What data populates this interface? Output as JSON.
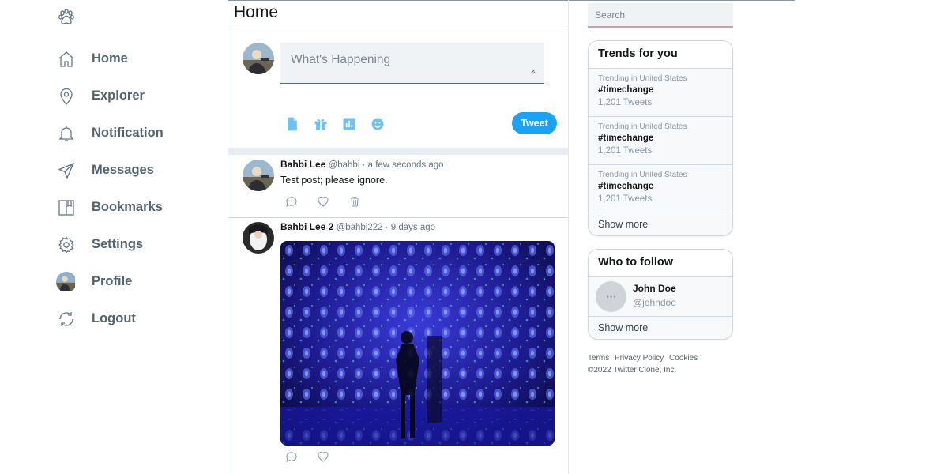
{
  "sidebar": {
    "logo_icon": "paw-icon",
    "items": [
      {
        "label": "Home",
        "icon": "home-icon"
      },
      {
        "label": "Explorer",
        "icon": "location-pin-icon"
      },
      {
        "label": "Notification",
        "icon": "bell-icon"
      },
      {
        "label": "Messages",
        "icon": "send-icon"
      },
      {
        "label": "Bookmarks",
        "icon": "bookmark-icon"
      },
      {
        "label": "Settings",
        "icon": "gear-icon"
      },
      {
        "label": "Profile",
        "icon": "avatar"
      },
      {
        "label": "Logout",
        "icon": "logout-icon"
      }
    ]
  },
  "main": {
    "title": "Home",
    "composer": {
      "placeholder": "What's Happening",
      "tools": [
        "file-icon",
        "gift-icon",
        "poll-icon",
        "emoji-icon"
      ],
      "tweet_label": "Tweet"
    },
    "posts": [
      {
        "name": "Bahbi Lee",
        "handle": "@bahbi",
        "time": "· a few seconds ago",
        "text": "Test post; please ignore.",
        "actions": [
          "comment-icon",
          "heart-icon",
          "trash-icon"
        ]
      },
      {
        "name": "Bahbi Lee 2",
        "handle": "@bahbi222",
        "time": "· 9 days ago",
        "text": "",
        "actions": [
          "comment-icon",
          "heart-icon"
        ]
      }
    ]
  },
  "right": {
    "search_placeholder": "Search",
    "trends": {
      "title": "Trends for you",
      "items": [
        {
          "context": "Trending in United States",
          "tag": "#timechange",
          "count": "1,201 Tweets"
        },
        {
          "context": "Trending in United States",
          "tag": "#timechange",
          "count": "1,201 Tweets"
        },
        {
          "context": "Trending in United States",
          "tag": "#timechange",
          "count": "1,201 Tweets"
        }
      ],
      "show_more": "Show more"
    },
    "follow": {
      "title": "Who to follow",
      "items": [
        {
          "name": "John Doe",
          "handle": "@johndoe"
        }
      ],
      "show_more": "Show more"
    },
    "footer": {
      "links": [
        "Terms",
        "Privacy Policy",
        "Cookies"
      ],
      "copyright": "©2022 Twitter Clone, Inc."
    }
  },
  "colors": {
    "accent": "#1da1f2",
    "icon": "#71c0f0",
    "search_underline": "#f28cae"
  }
}
